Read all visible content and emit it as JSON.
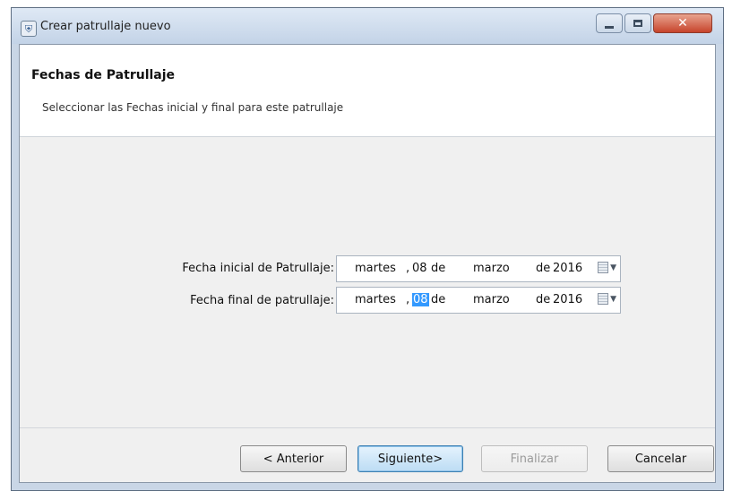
{
  "window": {
    "title": "Crear patrullaje nuevo"
  },
  "header": {
    "title": "Fechas de Patrullaje",
    "subtitle": "Seleccionar las Fechas inicial y final para este patrullaje"
  },
  "form": {
    "start": {
      "label": "Fecha inicial de Patrullaje:",
      "weekday": "martes",
      "separator": ",",
      "day": "08",
      "de1": "de",
      "month": "marzo",
      "de2": "de",
      "year": "2016"
    },
    "end": {
      "label": "Fecha final de patrullaje:",
      "weekday": "martes",
      "separator": ",",
      "day": "08",
      "de1": "de",
      "month": "marzo",
      "de2": "de",
      "year": "2016"
    }
  },
  "buttons": {
    "prev": "< Anterior",
    "next": "Siguiente>",
    "finish": "Finalizar",
    "cancel": "Cancelar"
  },
  "colors": {
    "selection": "#3399ff",
    "titlebar": "#c9d6e6",
    "close_button": "#c7442c"
  },
  "icons": {
    "app": "app-icon",
    "calendar": "calendar-icon",
    "dropdown": "chevron-down-icon",
    "close": "close-icon"
  }
}
